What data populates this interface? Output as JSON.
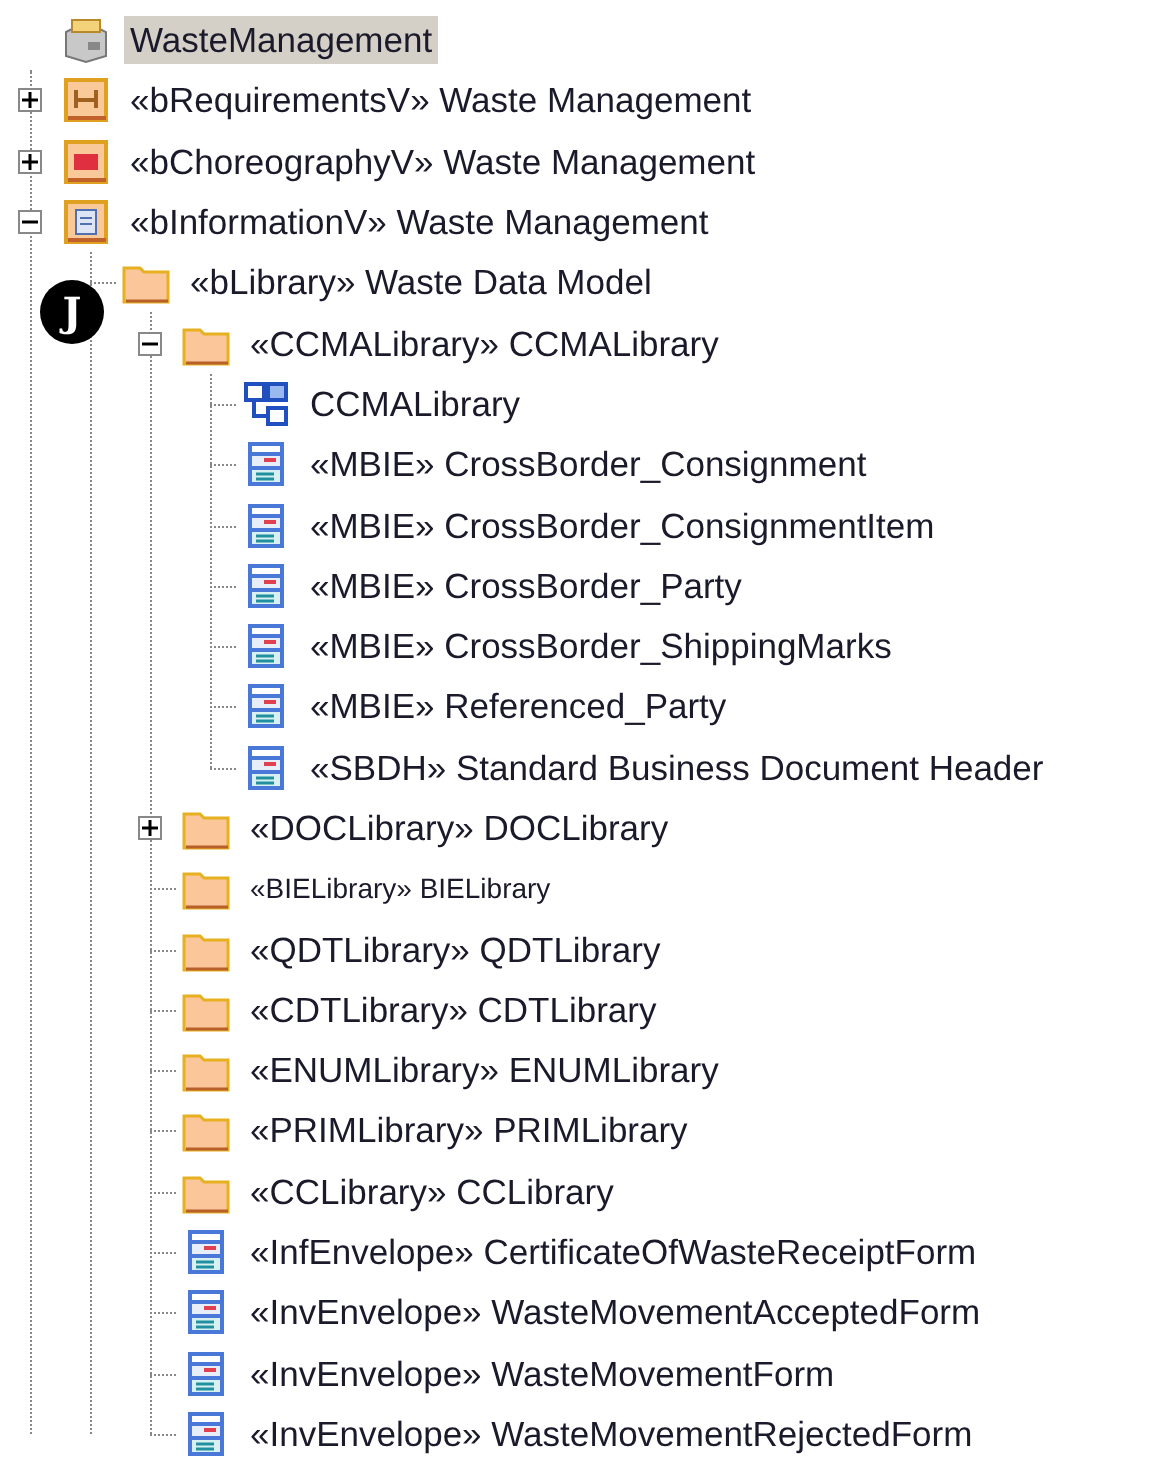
{
  "tree": {
    "label": "WasteManagement",
    "kind": "package",
    "selected": true,
    "children": [
      {
        "label": "«bRequirementsV» Waste Management",
        "kind": "requirements",
        "selected": false,
        "expanded": false
      },
      {
        "label": "«bChoreographyV» Waste Management",
        "kind": "choreography",
        "selected": false,
        "expanded": false
      },
      {
        "label": "«bInformationV» Waste Management",
        "kind": "information",
        "selected": false,
        "expanded": true,
        "children": [
          {
            "label": "«bLibrary» Waste Data Model",
            "kind": "folder",
            "selected": false,
            "badge": "J",
            "children": [
              {
                "label": "«CCMALibrary» CCMALibrary",
                "kind": "folder",
                "selected": false,
                "expanded": true,
                "children": [
                  {
                    "label": "CCMALibrary",
                    "kind": "diagram",
                    "selected": false
                  },
                  {
                    "label": "«MBIE» CrossBorder_Consignment",
                    "kind": "class",
                    "selected": false
                  },
                  {
                    "label": "«MBIE» CrossBorder_ConsignmentItem",
                    "kind": "class",
                    "selected": false
                  },
                  {
                    "label": "«MBIE» CrossBorder_Party",
                    "kind": "class",
                    "selected": false
                  },
                  {
                    "label": "«MBIE» CrossBorder_ShippingMarks",
                    "kind": "class",
                    "selected": false
                  },
                  {
                    "label": "«MBIE» Referenced_Party",
                    "kind": "class",
                    "selected": false
                  },
                  {
                    "label": "«SBDH» Standard Business Document Header",
                    "kind": "class",
                    "selected": false
                  }
                ]
              },
              {
                "label": "«DOCLibrary» DOCLibrary",
                "kind": "folder",
                "selected": false,
                "expanded": false
              },
              {
                "label": "«BIELibrary» BIELibrary",
                "kind": "folder",
                "selected": false,
                "small": true
              },
              {
                "label": "«QDTLibrary» QDTLibrary",
                "kind": "folder",
                "selected": false
              },
              {
                "label": "«CDTLibrary» CDTLibrary",
                "kind": "folder",
                "selected": false
              },
              {
                "label": "«ENUMLibrary» ENUMLibrary",
                "kind": "folder",
                "selected": false
              },
              {
                "label": "«PRIMLibrary» PRIMLibrary",
                "kind": "folder",
                "selected": false
              },
              {
                "label": "«CCLibrary» CCLibrary",
                "kind": "folder",
                "selected": false
              },
              {
                "label": "«InfEnvelope» CertificateOfWasteReceiptForm",
                "kind": "class",
                "selected": false
              },
              {
                "label": "«InvEnvelope» WasteMovementAcceptedForm",
                "kind": "class",
                "selected": false
              },
              {
                "label": "«InvEnvelope» WasteMovementForm",
                "kind": "class",
                "selected": false
              },
              {
                "label": "«InvEnvelope» WasteMovementRejectedForm",
                "kind": "class",
                "selected": false
              }
            ]
          }
        ]
      }
    ]
  }
}
